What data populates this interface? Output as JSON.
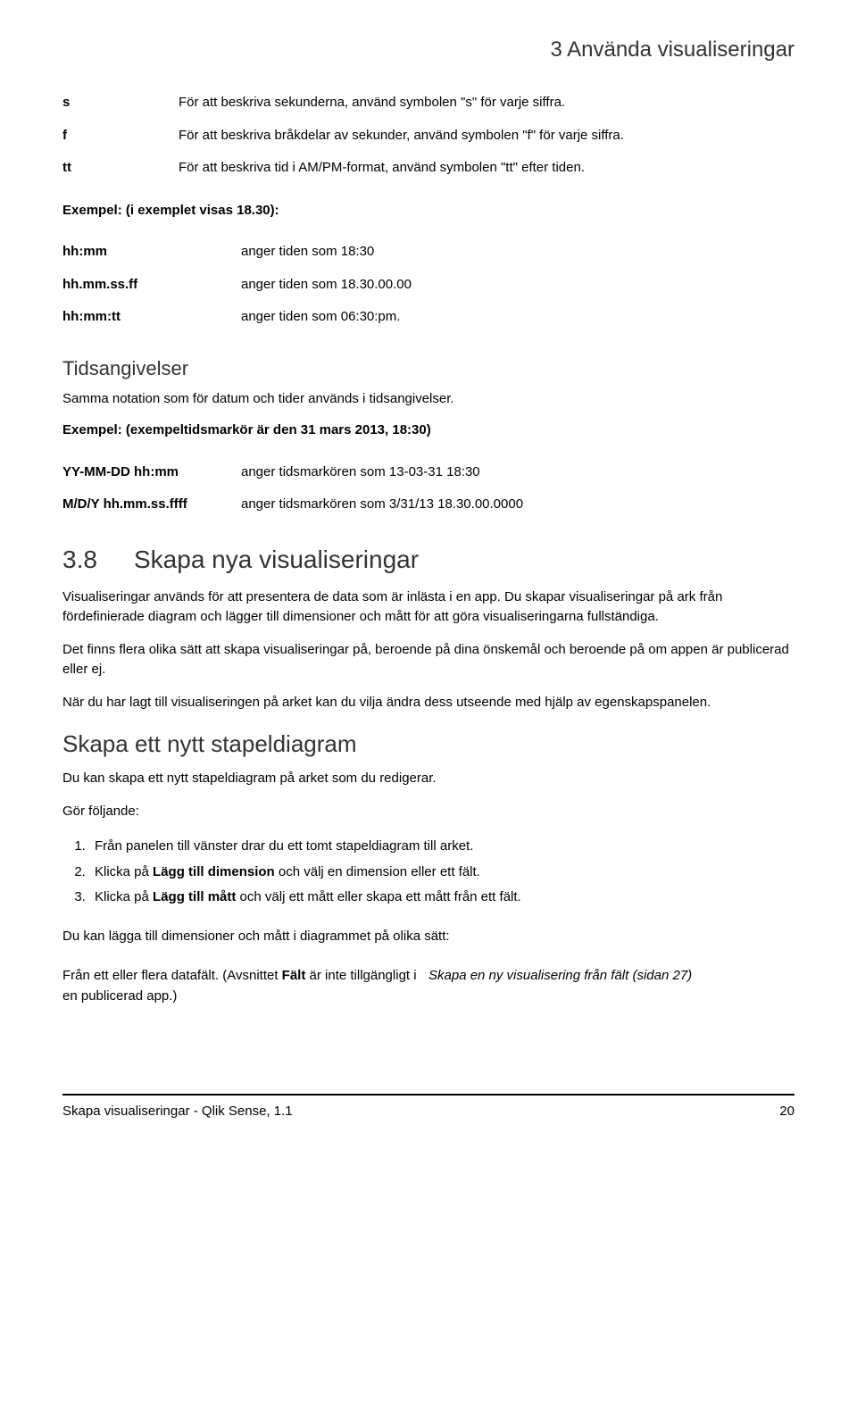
{
  "header": {
    "title": "3  Använda visualiseringar"
  },
  "symbols": [
    {
      "key": "s",
      "desc": "För att beskriva sekunderna, använd symbolen \"s\" för varje siffra."
    },
    {
      "key": "f",
      "desc": "För att beskriva bråkdelar av sekunder, använd symbolen \"f\" för varje siffra."
    },
    {
      "key": "tt",
      "desc": "För att beskriva tid i AM/PM-format, använd symbolen \"tt\" efter tiden."
    }
  ],
  "example1_label": "Exempel: (i exemplet visas 18.30):",
  "times": [
    {
      "key": "hh:mm",
      "desc": "anger tiden som 18:30"
    },
    {
      "key": "hh.mm.ss.ff",
      "desc": "anger tiden som 18.30.00.00"
    },
    {
      "key": "hh:mm:tt",
      "desc": "anger tiden som 06:30:pm."
    }
  ],
  "tids_heading": "Tidsangivelser",
  "tids_body": "Samma notation som för datum och tider används i tidsangivelser.",
  "example2_label": "Exempel: (exempeltidsmarkör är den 31 mars 2013, 18:30)",
  "timestamps": [
    {
      "key": "YY-MM-DD hh:mm",
      "desc": "anger tidsmarkören som 13-03-31 18:30"
    },
    {
      "key": "M/D/Y hh.mm.ss.ffff",
      "desc": "anger tidsmarkören som 3/31/13 18.30.00.0000"
    }
  ],
  "sec38": {
    "num": "3.8",
    "title": "Skapa nya visualiseringar",
    "p1": "Visualiseringar används för att presentera de data som är inlästa i en app. Du skapar visualiseringar på ark från fördefinierade diagram och lägger till dimensioner och mått för att göra visualiseringarna fullständiga.",
    "p2": "Det finns flera olika sätt att skapa visualiseringar på, beroende på dina önskemål och beroende på om appen är publicerad eller ej.",
    "p3": "När du har lagt till visualiseringen på arket kan du vilja ändra dess utseende med hjälp av egenskapspanelen."
  },
  "stapel": {
    "title": "Skapa ett nytt stapeldiagram",
    "intro": "Du kan skapa ett nytt stapeldiagram på arket som du redigerar.",
    "gor": "Gör följande:",
    "steps": [
      {
        "pre": "Från panelen till vänster drar du ett tomt stapeldiagram till arket."
      },
      {
        "pre": "Klicka på ",
        "bold": "Lägg till dimension",
        "post": " och välj en dimension eller ett fält."
      },
      {
        "pre": "Klicka på ",
        "bold": "Lägg till mått",
        "post": " och välj ett mått eller skapa ett mått från ett fält."
      }
    ],
    "after": "Du kan lägga till dimensioner och mått i diagrammet på olika sätt:",
    "row_left_a": "Från ett eller flera datafält. (Avsnittet ",
    "row_left_bold": "Fält",
    "row_left_b": " är inte tillgängligt i en publicerad app.)",
    "row_right": "Skapa en ny visualisering från fält (sidan 27)"
  },
  "footer": {
    "left": "Skapa visualiseringar - Qlik Sense, 1.1",
    "right": "20"
  }
}
